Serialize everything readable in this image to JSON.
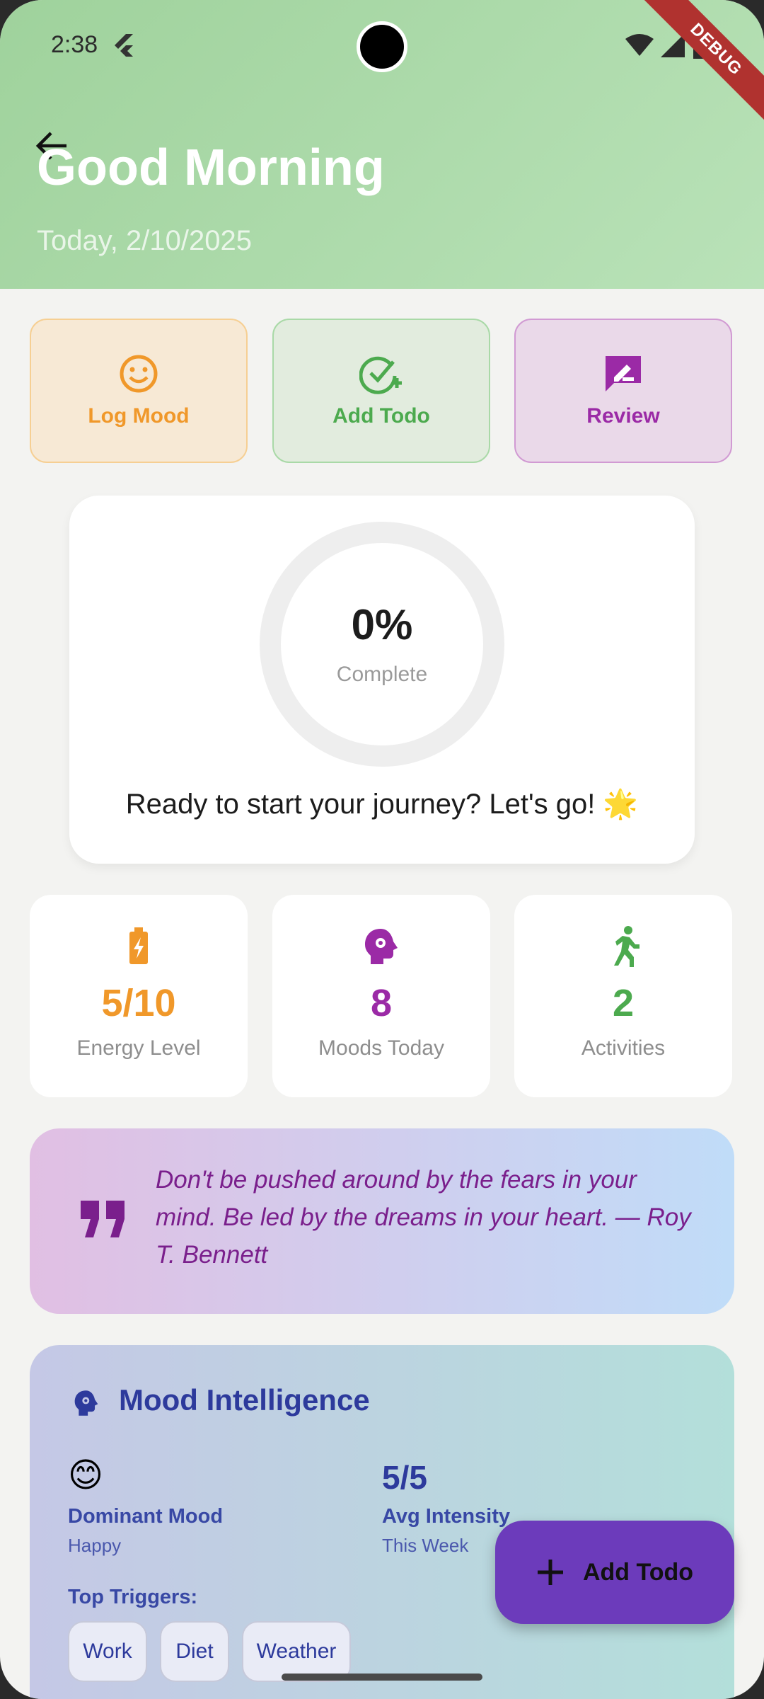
{
  "status_bar": {
    "time": "2:38",
    "debug_label": "DEBUG"
  },
  "header": {
    "greeting": "Good Morning",
    "date": "Today, 2/10/2025"
  },
  "quick_actions": [
    {
      "label": "Log Mood",
      "icon": "smiley-icon",
      "color": "#f0982a"
    },
    {
      "label": "Add Todo",
      "icon": "check-plus-icon",
      "color": "#4caa4e"
    },
    {
      "label": "Review",
      "icon": "rate-review-icon",
      "color": "#9b2aa6"
    }
  ],
  "progress": {
    "percent_text": "0%",
    "percent_value": 0,
    "label": "Complete",
    "message": "Ready to start your journey? Let's go! 🌟"
  },
  "stats": [
    {
      "value": "5/10",
      "label": "Energy Level",
      "icon": "battery-charging-icon",
      "color": "#f0982a"
    },
    {
      "value": "8",
      "label": "Moods Today",
      "icon": "psychology-icon",
      "color": "#9b2aa6"
    },
    {
      "value": "2",
      "label": "Activities",
      "icon": "running-icon",
      "color": "#4caa4e"
    }
  ],
  "quote": {
    "text": "Don't be pushed around by the fears in your mind. Be led by the dreams in your heart. — Roy T. Bennett"
  },
  "mood_intelligence": {
    "title": "Mood Intelligence",
    "dominant_emoji": "😊",
    "dominant_label": "Dominant Mood",
    "dominant_value": "Happy",
    "avg_value": "5/5",
    "avg_label": "Avg Intensity",
    "avg_sub": "This Week",
    "triggers_label": "Top Triggers:",
    "triggers": [
      "Work",
      "Diet",
      "Weather"
    ]
  },
  "fab": {
    "label": "Add Todo",
    "icon": "plus-icon"
  }
}
